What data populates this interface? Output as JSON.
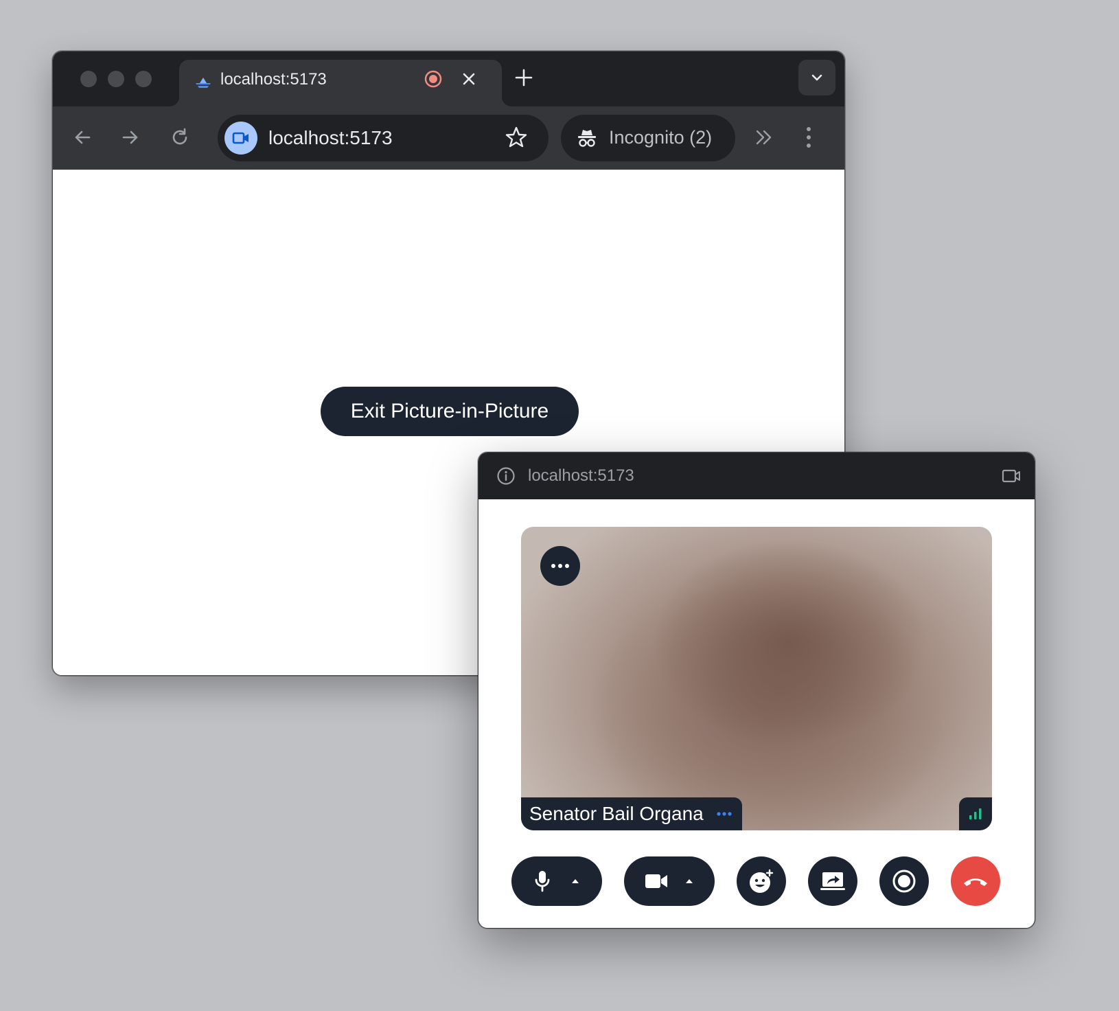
{
  "browser": {
    "tab": {
      "title": "localhost:5173"
    },
    "omnibox": {
      "url": "localhost:5173"
    },
    "incognito": {
      "label": "Incognito (2)"
    }
  },
  "page": {
    "exit_pip_label": "Exit Picture-in-Picture"
  },
  "pip": {
    "url": "localhost:5173",
    "participant": {
      "name": "Senator Bail Organa"
    },
    "controls": [
      "microphone",
      "camera",
      "reactions",
      "screen-share",
      "record",
      "leave-call"
    ]
  },
  "colors": {
    "chrome_dark": "#202124",
    "chrome_toolbar": "#35363a",
    "control_bg": "#1b2430",
    "leave_red": "#e64a43",
    "signal_green": "#1ec28b",
    "accent_blue": "#3b82f6"
  },
  "icons": {
    "tab": [
      "ship-favicon-icon",
      "record-indicator-icon",
      "close-icon",
      "plus-icon",
      "chevron-down-icon"
    ],
    "toolbar": [
      "arrow-left-icon",
      "arrow-right-icon",
      "reload-icon",
      "video-camera-icon",
      "star-icon",
      "incognito-icon",
      "double-chevron-right-icon",
      "kebab-menu-icon"
    ],
    "pip": [
      "info-icon",
      "back-to-tab-icon",
      "more-horizontal-icon",
      "signal-bars-icon",
      "microphone-icon",
      "caret-up-icon",
      "video-camera-icon",
      "smiley-plus-icon",
      "screen-share-icon",
      "record-icon",
      "phone-hangup-icon"
    ]
  }
}
